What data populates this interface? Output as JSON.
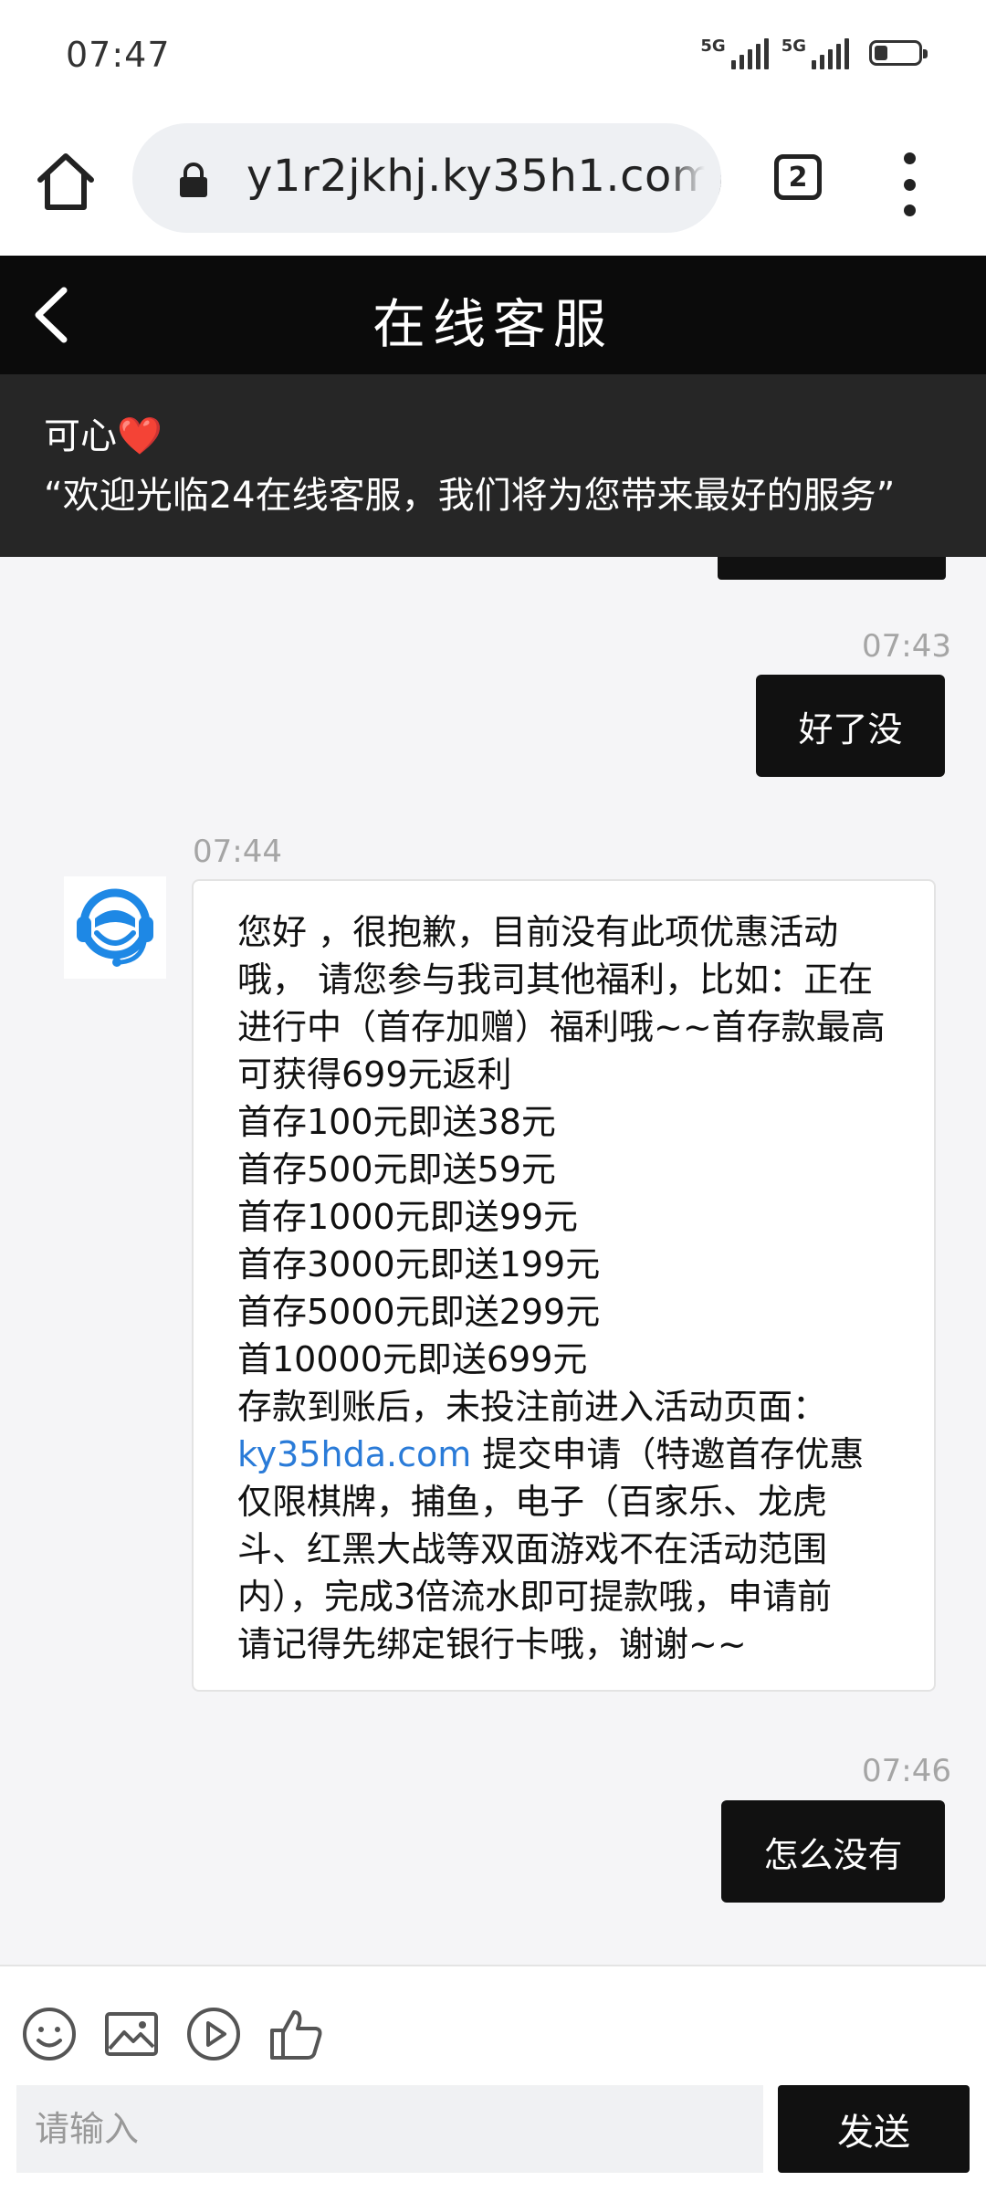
{
  "status_bar": {
    "time": "07:47",
    "signal1_label": "5G",
    "signal2_label": "5G",
    "battery_level": 0.3
  },
  "browser": {
    "url": "y1r2jkhj.ky35h1.com/",
    "tab_count": "2"
  },
  "header": {
    "title": "在线客服"
  },
  "notice": {
    "agent_name": "可心❤️",
    "text": "“欢迎光临24在线客服，我们将为您带来最好的服务”"
  },
  "messages": [
    {
      "direction": "out",
      "time": "07:43",
      "text": "好了没"
    },
    {
      "direction": "in",
      "time": "07:44",
      "lines": [
        "您好 ，很抱歉，目前没有此项优惠活动",
        "哦， 请您参与我司其他福利，比如：正在",
        "进行中（首存加赠）福利哦~~首存款最高",
        "可获得699元返利",
        "首存100元即送38元",
        "首存500元即送59元",
        "首存1000元即送99元",
        "首存3000元即送199元",
        "首存5000元即送299元",
        "首10000元即送699元",
        "存款到账后，未投注前进入活动页面："
      ],
      "link": "ky35hda.com",
      "link_after": " 提交申请（特邀首存优惠",
      "lines_after": [
        "仅限棋牌，捕鱼，电子（百家乐、龙虎",
        "斗、红黑大战等双面游戏不在活动范围",
        "内），完成3倍流水即可提款哦，申请前",
        "请记得先绑定银行卡哦，谢谢~~"
      ]
    },
    {
      "direction": "out",
      "time": "07:46",
      "text": "怎么没有"
    }
  ],
  "input": {
    "placeholder": "请输入",
    "value": "",
    "send_label": "发送"
  },
  "colors": {
    "header_bg": "#0b0b0b",
    "notice_bg": "#262626",
    "bubble_out": "#111111",
    "link": "#2a7bd8",
    "avatar_blue": "#1e88e5"
  }
}
